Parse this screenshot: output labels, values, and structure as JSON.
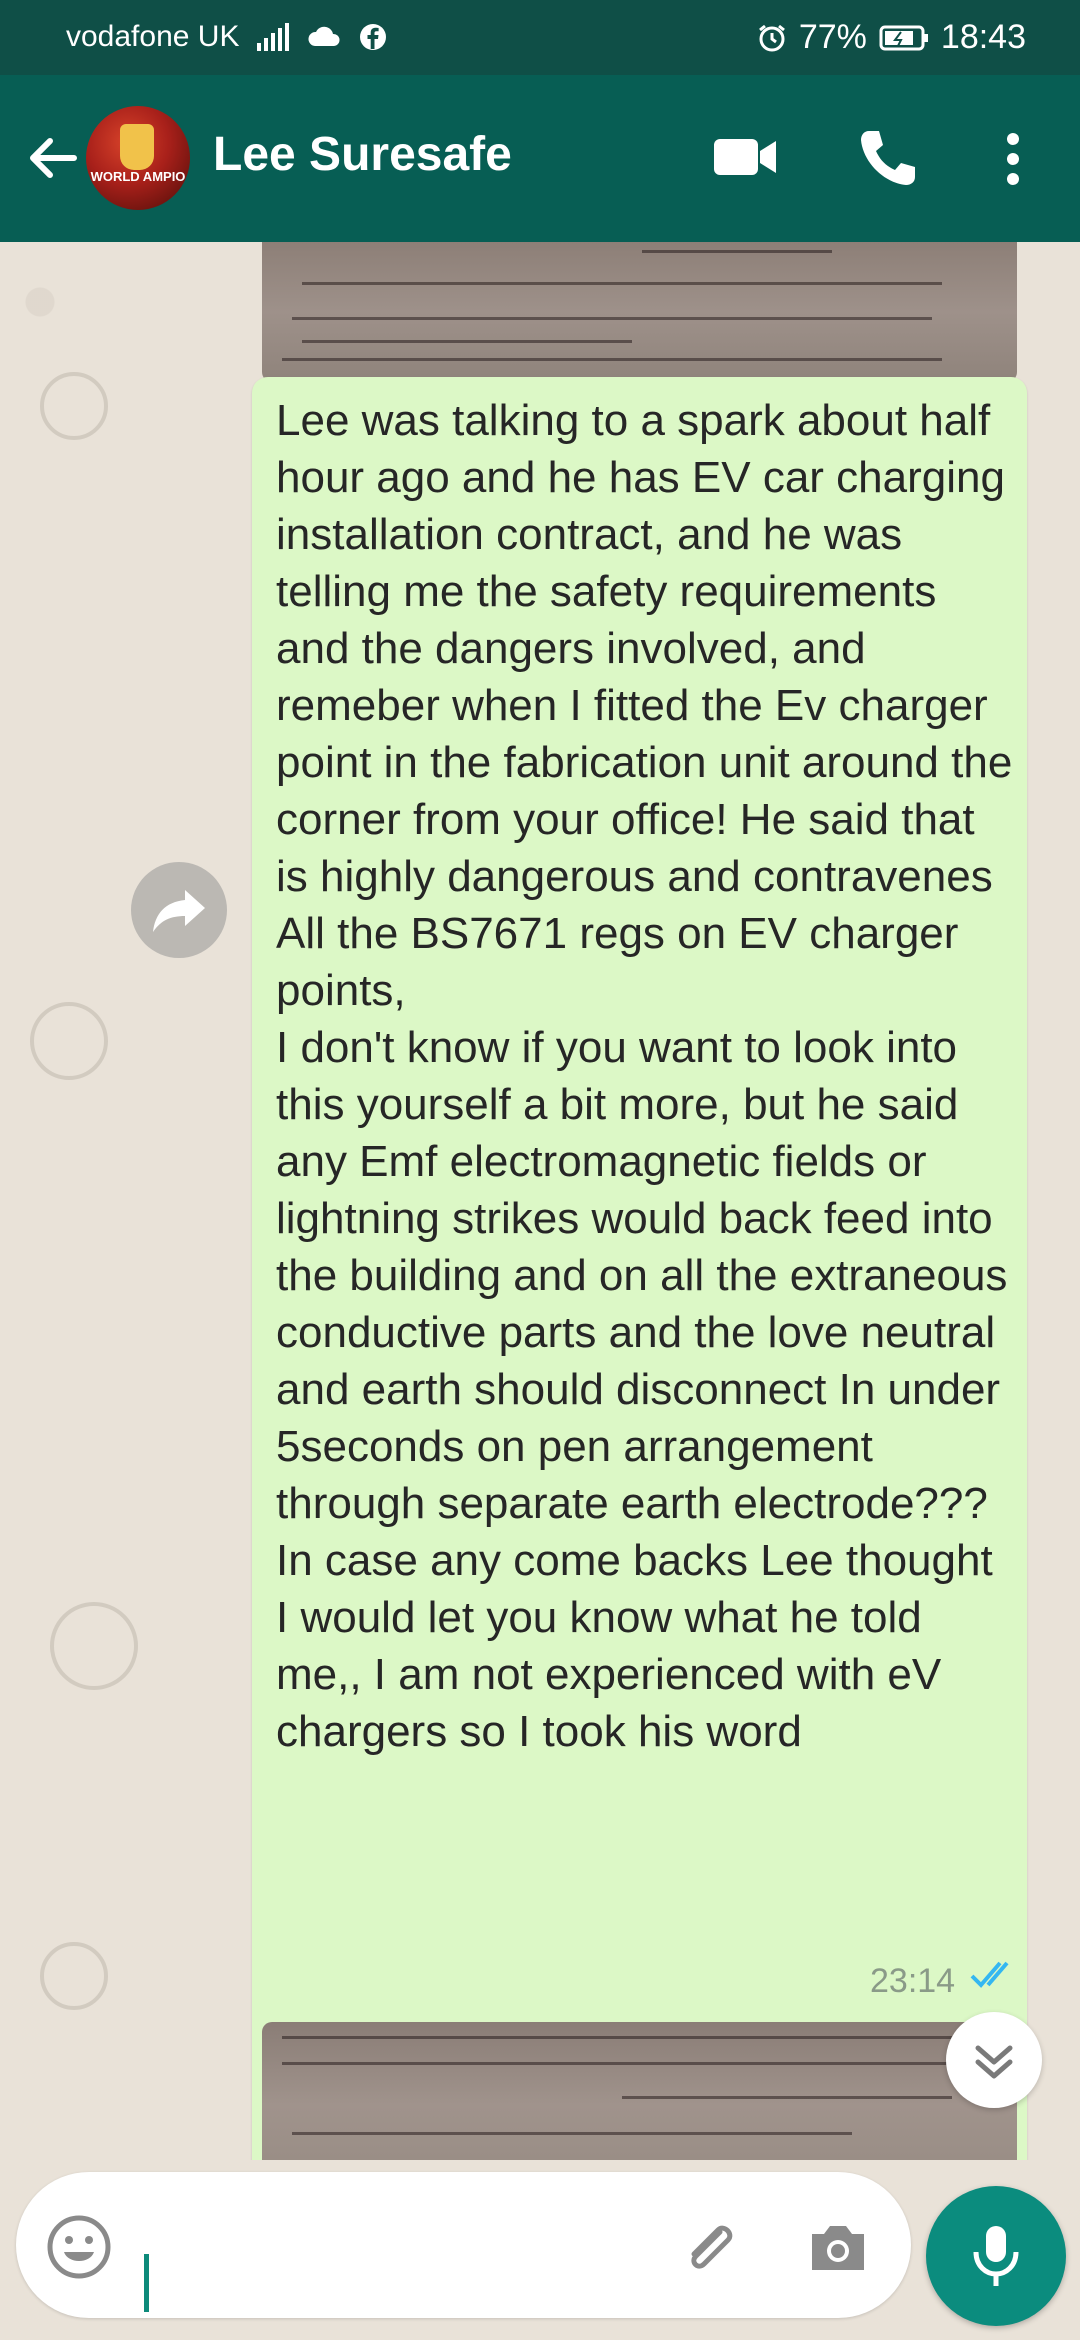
{
  "status_bar": {
    "carrier": "vodafone UK",
    "battery": "77%",
    "time": "18:43"
  },
  "header": {
    "contact_name": "Lee Suresafe",
    "avatar_text": "WORLD AMPIO"
  },
  "message": {
    "paragraphs": [
      "Lee was talking to a spark about half hour ago and he has EV car charging installation contract, and he was telling me the safety requirements and the dangers involved, and remeber when I fitted the Ev charger point in the fabrication unit around the corner from your office!  He said that is highly dangerous and contravenes All the BS7671 regs on EV charger points,",
      "I don't know if you want to look into this yourself a bit more, but he said any Emf electromagnetic fields or lightning strikes would back feed into the building and on all the extraneous conductive parts and the love neutral and earth should disconnect In under 5seconds on pen arrangement through separate earth electrode???",
      "In case any come backs Lee thought I would let you know what he told me,,  I am not experienced with eV chargers so I took his word"
    ],
    "time": "23:14"
  },
  "colors": {
    "header": "#075e54",
    "bubble": "#dcf8c6",
    "accent": "#0b8c7e"
  },
  "icons": [
    "back-arrow-icon",
    "video-call-icon",
    "phone-icon",
    "menu-icon",
    "forward-icon",
    "chevron-down-icon",
    "emoji-icon",
    "attach-icon",
    "camera-icon",
    "mic-icon",
    "read-ticks-icon"
  ]
}
